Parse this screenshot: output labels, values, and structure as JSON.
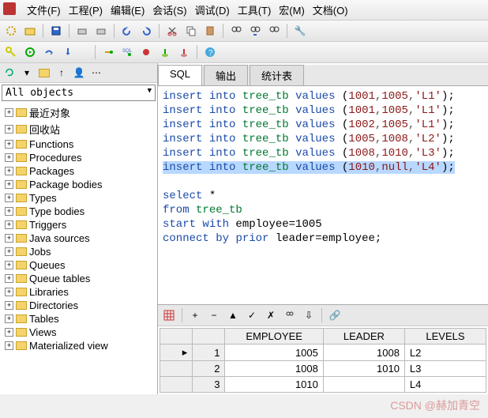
{
  "menu": [
    "文件(F)",
    "工程(P)",
    "编辑(E)",
    "会话(S)",
    "调试(D)",
    "工具(T)",
    "宏(M)",
    "文档(O)"
  ],
  "sidebar": {
    "dropdown": "All objects",
    "items": [
      "最近对象",
      "回收站",
      "Functions",
      "Procedures",
      "Packages",
      "Package bodies",
      "Types",
      "Type bodies",
      "Triggers",
      "Java sources",
      "Jobs",
      "Queues",
      "Queue tables",
      "Libraries",
      "Directories",
      "Tables",
      "Views",
      "Materialized view"
    ]
  },
  "tabs": [
    "SQL",
    "输出",
    "统计表"
  ],
  "sql_lines": [
    {
      "t": "insert into tree_tb values (1001,1005,'L1');",
      "hl": false
    },
    {
      "t": "insert into tree_tb values (1001,1005,'L1');",
      "hl": false
    },
    {
      "t": "insert into tree_tb values (1002,1005,'L1');",
      "hl": false
    },
    {
      "t": "insert into tree_tb values (1005,1008,'L2');",
      "hl": false
    },
    {
      "t": "insert into tree_tb values (1008,1010,'L3');",
      "hl": false
    },
    {
      "t": "insert into tree_tb values (1010,null,'L4');",
      "hl": true
    }
  ],
  "sql_query": [
    "select *",
    "from tree_tb",
    "start with employee=1005",
    "connect by prior leader=employee;"
  ],
  "grid": {
    "headers": [
      "EMPLOYEE",
      "LEADER",
      "LEVELS"
    ],
    "rows": [
      {
        "n": "1",
        "emp": "1005",
        "lead": "1008",
        "lvl": "L2",
        "cur": true
      },
      {
        "n": "2",
        "emp": "1008",
        "lead": "1010",
        "lvl": "L3",
        "cur": false
      },
      {
        "n": "3",
        "emp": "1010",
        "lead": "",
        "lvl": "L4",
        "cur": false
      }
    ]
  },
  "chart_data": {
    "type": "table",
    "title": "tree_tb hierarchical query result",
    "columns": [
      "EMPLOYEE",
      "LEADER",
      "LEVELS"
    ],
    "rows": [
      [
        1005,
        1008,
        "L2"
      ],
      [
        1008,
        1010,
        "L3"
      ],
      [
        1010,
        null,
        "L4"
      ]
    ]
  },
  "watermark": "CSDN @赫加青空"
}
